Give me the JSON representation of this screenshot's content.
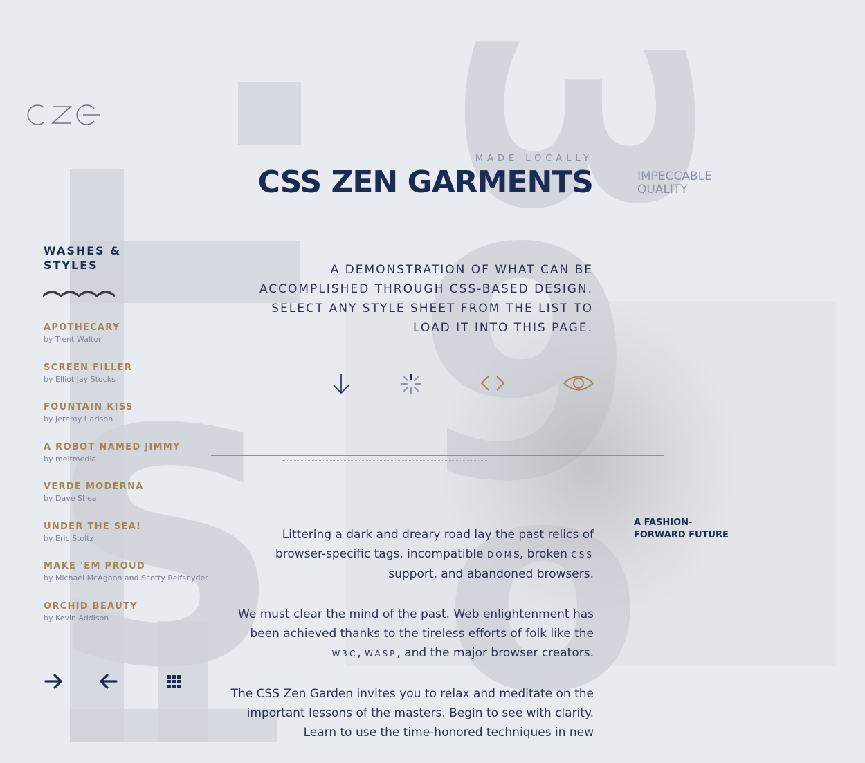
{
  "site": {
    "logo_text": "CZG",
    "tagline": "MADE LOCALLY",
    "title": "CSS ZEN GARMENTS",
    "quality": "IMPECCABLE QUALITY"
  },
  "sidebar": {
    "heading": "WASHES & STYLES",
    "by_prefix": "by",
    "items": [
      {
        "name": "APOTHECARY",
        "author": "Trent Walton"
      },
      {
        "name": "SCREEN FILLER",
        "author": "Elliot Jay Stocks"
      },
      {
        "name": "FOUNTAIN KISS",
        "author": "Jeremy Carlson"
      },
      {
        "name": "A ROBOT NAMED JIMMY",
        "author": "meltmedia"
      },
      {
        "name": "VERDE MODERNA",
        "author": "Dave Shea"
      },
      {
        "name": "UNDER THE SEA!",
        "author": "Eric Stoltz"
      },
      {
        "name": "MAKE 'EM PROUD",
        "author": "Michael McAghon and Scotty Reifsnyder"
      },
      {
        "name": "ORCHID BEAUTY",
        "author": "Kevin Addison"
      }
    ],
    "nav_icons": [
      "arrow-right-icon",
      "arrow-left-icon",
      "grid-icon"
    ]
  },
  "intro": {
    "text": "A DEMONSTRATION OF WHAT CAN BE ACCOMPLISHED THROUGH CSS-BASED DESIGN. SELECT ANY STYLE SHEET FROM THE LIST TO LOAD IT INTO THIS PAGE."
  },
  "actions": [
    "arrow-down-icon",
    "spinner-icon",
    "code-brackets-icon",
    "eye-icon"
  ],
  "colors": {
    "navy": "#1a2c52",
    "gold": "#a9844f",
    "background": "#e8ecf1",
    "muted": "#8a90a0"
  },
  "aside": {
    "label": "A FASHION-FORWARD FUTURE"
  },
  "body": {
    "p1_a": "Littering a dark and dreary road lay the past relics of browser-specific tags, incompatible ",
    "p1_dom": "DOM",
    "p1_b": "s, broken ",
    "p1_css": "CSS",
    "p1_c": " support, and abandoned browsers.",
    "p2_a": "We must clear the mind of the past. Web enlightenment has been achieved thanks to the tireless efforts of folk like the ",
    "p2_w3c": "W3C",
    "p2_sep": ", ",
    "p2_wasp": "WASP",
    "p2_b": ", and the major browser creators.",
    "p3": "The CSS Zen Garden invites you to relax and meditate on the important lessons of the masters. Begin to see with clarity. Learn to use the time-honored techniques in new"
  }
}
